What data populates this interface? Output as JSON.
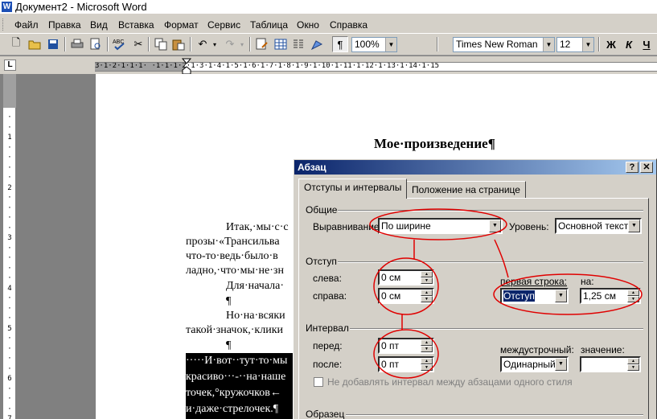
{
  "window": {
    "title": "Документ2 - Microsoft Word",
    "app_icon": "W"
  },
  "menu": [
    "Файл",
    "Правка",
    "Вид",
    "Вставка",
    "Формат",
    "Сервис",
    "Таблица",
    "Окно",
    "Справка"
  ],
  "toolbar": {
    "zoom": "100%",
    "font": "Times New Roman",
    "size": "12",
    "bold": "Ж",
    "italic": "К",
    "underline": "Ч",
    "pilcrow": "¶"
  },
  "ruler": {
    "corner": "L",
    "marks": "3·1·2·1·1·1· ·1·1·1·2·1·3·1·4·1·5·1·6·1·7·1·8·1·9·1·10·1·11·1·12·1·13·1·14·1·15"
  },
  "document": {
    "heading": "Мое·произведение¶",
    "lines": [
      "Итак,·мы·с·с",
      "прозы·«Трансильва",
      "что-то·ведь·было·в",
      "ладно,·что·мы·не·зн",
      "Для·начала·",
      "¶",
      "Но·на·всяки",
      "такой·значок,·клики",
      "¶"
    ],
    "selected_lines": [
      "·····И·вот··тут·то·мы",
      "красиво···-··на·наше",
      "точек,°кружочков←",
      "и·даже·стрелочек.¶"
    ],
    "after_selection": "¶"
  },
  "dialog": {
    "title": "Абзац",
    "help_btn": "?",
    "close_btn": "✕",
    "tabs": [
      "Отступы и интервалы",
      "Положение на странице"
    ],
    "general": {
      "group": "Общие",
      "alignment_label": "Выравнивание:",
      "alignment_value": "По ширине",
      "level_label": "Уровень:",
      "level_value": "Основной текст"
    },
    "indent": {
      "group": "Отступ",
      "left_label": "слева:",
      "left_value": "0 см",
      "right_label": "справа:",
      "right_value": "0 см",
      "first_line_label": "первая строка:",
      "first_line_value": "Отступ",
      "by_label": "на:",
      "by_value": "1,25 см"
    },
    "spacing": {
      "group": "Интервал",
      "before_label": "перед:",
      "before_value": "0 пт",
      "after_label": "после:",
      "after_value": "0 пт",
      "line_label": "междустрочный:",
      "line_value": "Одинарный",
      "at_label": "значение:",
      "at_value": ""
    },
    "no_space_checkbox": "Не добавлять интервал между абзацами одного стиля",
    "preview_group": "Образец"
  },
  "colors": {
    "annotation": "#e00000",
    "titlebar": "#0a246a",
    "chrome": "#d4d0c8"
  }
}
